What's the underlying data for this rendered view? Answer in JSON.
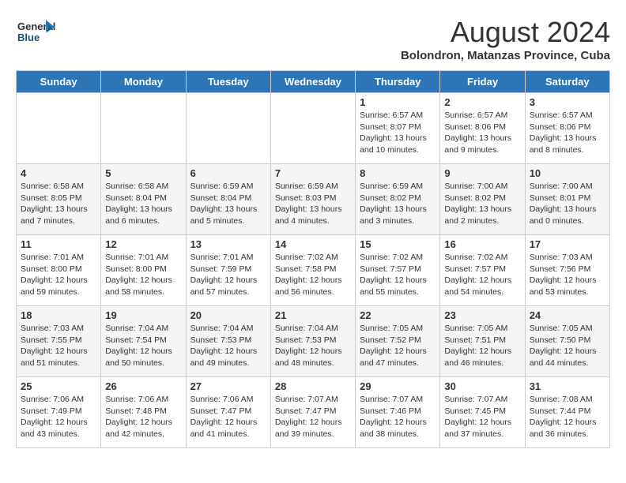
{
  "logo": {
    "text_general": "General",
    "text_blue": "Blue"
  },
  "title": "August 2024",
  "subtitle": "Bolondron, Matanzas Province, Cuba",
  "days_of_week": [
    "Sunday",
    "Monday",
    "Tuesday",
    "Wednesday",
    "Thursday",
    "Friday",
    "Saturday"
  ],
  "weeks": [
    [
      {
        "day": "",
        "info": ""
      },
      {
        "day": "",
        "info": ""
      },
      {
        "day": "",
        "info": ""
      },
      {
        "day": "",
        "info": ""
      },
      {
        "day": "1",
        "info": "Sunrise: 6:57 AM\nSunset: 8:07 PM\nDaylight: 13 hours\nand 10 minutes."
      },
      {
        "day": "2",
        "info": "Sunrise: 6:57 AM\nSunset: 8:06 PM\nDaylight: 13 hours\nand 9 minutes."
      },
      {
        "day": "3",
        "info": "Sunrise: 6:57 AM\nSunset: 8:06 PM\nDaylight: 13 hours\nand 8 minutes."
      }
    ],
    [
      {
        "day": "4",
        "info": "Sunrise: 6:58 AM\nSunset: 8:05 PM\nDaylight: 13 hours\nand 7 minutes."
      },
      {
        "day": "5",
        "info": "Sunrise: 6:58 AM\nSunset: 8:04 PM\nDaylight: 13 hours\nand 6 minutes."
      },
      {
        "day": "6",
        "info": "Sunrise: 6:59 AM\nSunset: 8:04 PM\nDaylight: 13 hours\nand 5 minutes."
      },
      {
        "day": "7",
        "info": "Sunrise: 6:59 AM\nSunset: 8:03 PM\nDaylight: 13 hours\nand 4 minutes."
      },
      {
        "day": "8",
        "info": "Sunrise: 6:59 AM\nSunset: 8:02 PM\nDaylight: 13 hours\nand 3 minutes."
      },
      {
        "day": "9",
        "info": "Sunrise: 7:00 AM\nSunset: 8:02 PM\nDaylight: 13 hours\nand 2 minutes."
      },
      {
        "day": "10",
        "info": "Sunrise: 7:00 AM\nSunset: 8:01 PM\nDaylight: 13 hours\nand 0 minutes."
      }
    ],
    [
      {
        "day": "11",
        "info": "Sunrise: 7:01 AM\nSunset: 8:00 PM\nDaylight: 12 hours\nand 59 minutes."
      },
      {
        "day": "12",
        "info": "Sunrise: 7:01 AM\nSunset: 8:00 PM\nDaylight: 12 hours\nand 58 minutes."
      },
      {
        "day": "13",
        "info": "Sunrise: 7:01 AM\nSunset: 7:59 PM\nDaylight: 12 hours\nand 57 minutes."
      },
      {
        "day": "14",
        "info": "Sunrise: 7:02 AM\nSunset: 7:58 PM\nDaylight: 12 hours\nand 56 minutes."
      },
      {
        "day": "15",
        "info": "Sunrise: 7:02 AM\nSunset: 7:57 PM\nDaylight: 12 hours\nand 55 minutes."
      },
      {
        "day": "16",
        "info": "Sunrise: 7:02 AM\nSunset: 7:57 PM\nDaylight: 12 hours\nand 54 minutes."
      },
      {
        "day": "17",
        "info": "Sunrise: 7:03 AM\nSunset: 7:56 PM\nDaylight: 12 hours\nand 53 minutes."
      }
    ],
    [
      {
        "day": "18",
        "info": "Sunrise: 7:03 AM\nSunset: 7:55 PM\nDaylight: 12 hours\nand 51 minutes."
      },
      {
        "day": "19",
        "info": "Sunrise: 7:04 AM\nSunset: 7:54 PM\nDaylight: 12 hours\nand 50 minutes."
      },
      {
        "day": "20",
        "info": "Sunrise: 7:04 AM\nSunset: 7:53 PM\nDaylight: 12 hours\nand 49 minutes."
      },
      {
        "day": "21",
        "info": "Sunrise: 7:04 AM\nSunset: 7:53 PM\nDaylight: 12 hours\nand 48 minutes."
      },
      {
        "day": "22",
        "info": "Sunrise: 7:05 AM\nSunset: 7:52 PM\nDaylight: 12 hours\nand 47 minutes."
      },
      {
        "day": "23",
        "info": "Sunrise: 7:05 AM\nSunset: 7:51 PM\nDaylight: 12 hours\nand 46 minutes."
      },
      {
        "day": "24",
        "info": "Sunrise: 7:05 AM\nSunset: 7:50 PM\nDaylight: 12 hours\nand 44 minutes."
      }
    ],
    [
      {
        "day": "25",
        "info": "Sunrise: 7:06 AM\nSunset: 7:49 PM\nDaylight: 12 hours\nand 43 minutes."
      },
      {
        "day": "26",
        "info": "Sunrise: 7:06 AM\nSunset: 7:48 PM\nDaylight: 12 hours\nand 42 minutes."
      },
      {
        "day": "27",
        "info": "Sunrise: 7:06 AM\nSunset: 7:47 PM\nDaylight: 12 hours\nand 41 minutes."
      },
      {
        "day": "28",
        "info": "Sunrise: 7:07 AM\nSunset: 7:47 PM\nDaylight: 12 hours\nand 39 minutes."
      },
      {
        "day": "29",
        "info": "Sunrise: 7:07 AM\nSunset: 7:46 PM\nDaylight: 12 hours\nand 38 minutes."
      },
      {
        "day": "30",
        "info": "Sunrise: 7:07 AM\nSunset: 7:45 PM\nDaylight: 12 hours\nand 37 minutes."
      },
      {
        "day": "31",
        "info": "Sunrise: 7:08 AM\nSunset: 7:44 PM\nDaylight: 12 hours\nand 36 minutes."
      }
    ]
  ]
}
